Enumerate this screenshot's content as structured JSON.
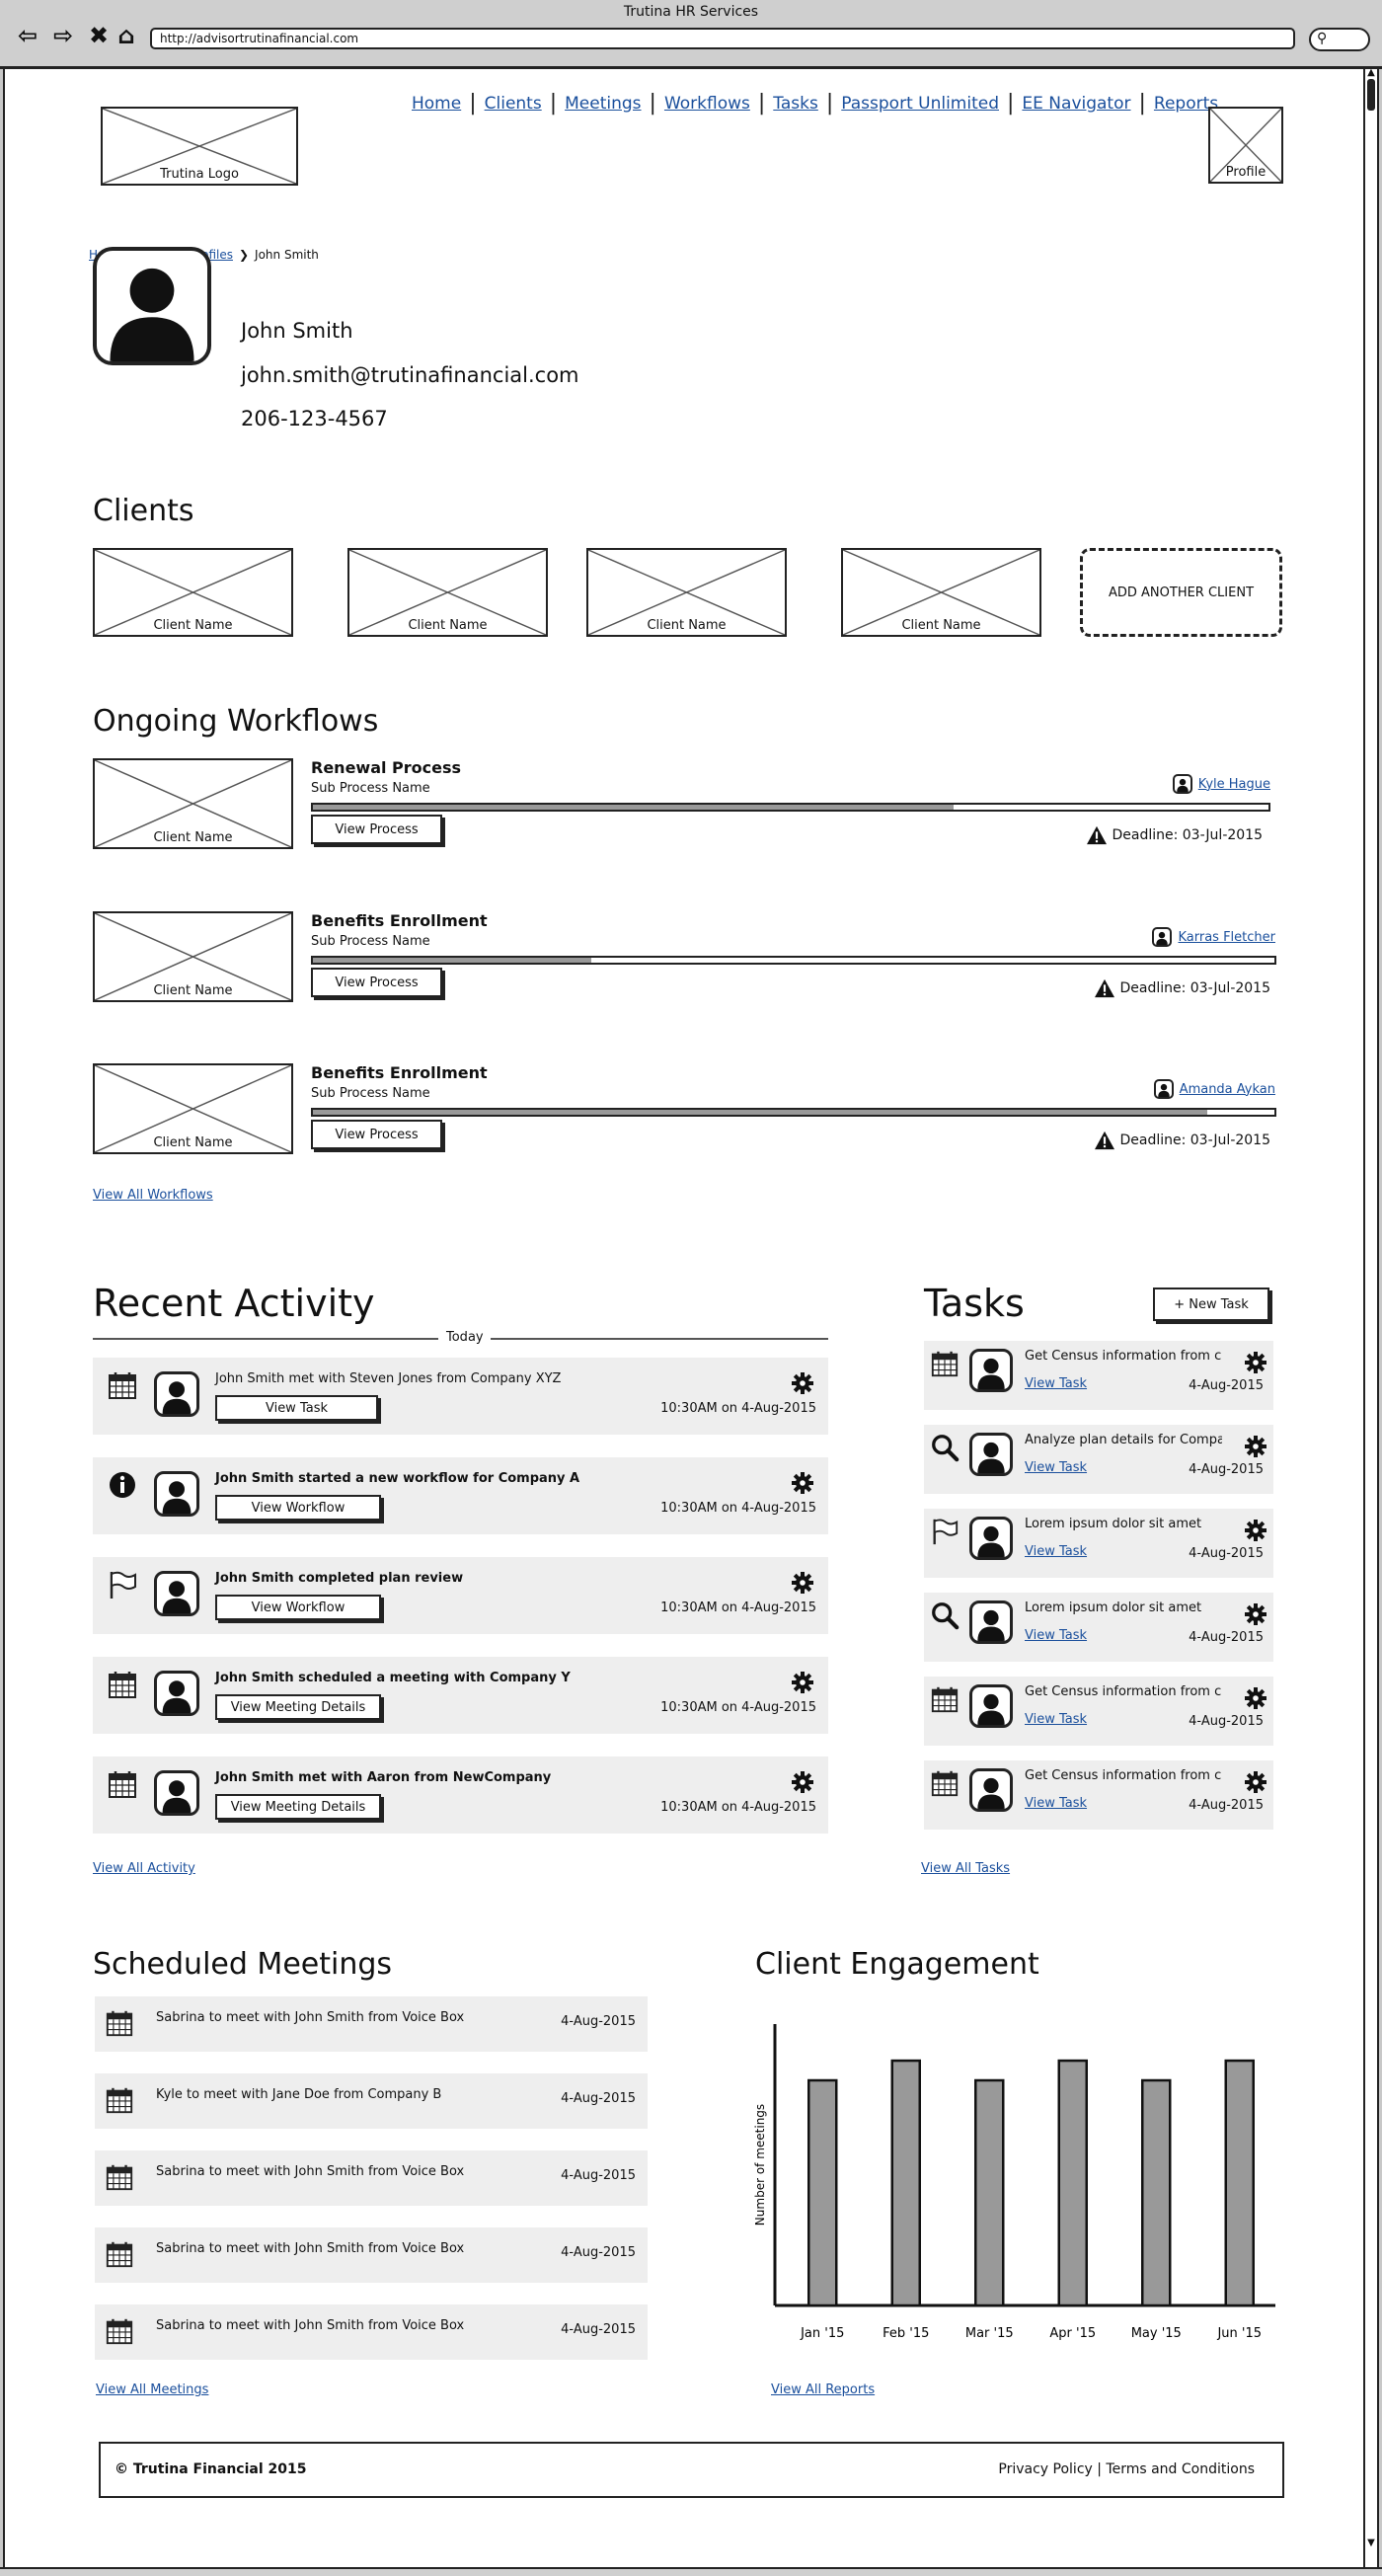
{
  "window": {
    "title": "Trutina HR Services",
    "url": "http://advisortrutinafinancial.com"
  },
  "header": {
    "logo_caption": "Trutina Logo",
    "profile_caption": "Profile",
    "nav": [
      "Home",
      "Clients",
      "Meetings",
      "Workflows",
      "Tasks",
      "Passport Unlimited",
      "EE Navigator",
      "Reports"
    ]
  },
  "breadcrumb": {
    "home": "Home",
    "profiles": "Trutina Profiles",
    "current": "John Smith"
  },
  "profile": {
    "name": "John Smith",
    "email": "john.smith@trutinafinancial.com",
    "phone": "206-123-4567"
  },
  "clients": {
    "title": "Clients",
    "items": [
      "Client Name",
      "Client Name",
      "Client Name",
      "Client Name"
    ],
    "add_label": "ADD ANOTHER CLIENT"
  },
  "workflows": {
    "title": "Ongoing Workflows",
    "items": [
      {
        "client": "Client Name",
        "title": "Renewal Process",
        "sub": "Sub Process Name",
        "button": "View Process",
        "owner": "Kyle Hague",
        "deadline": "Deadline: 03-Jul-2015",
        "progress": 0.67
      },
      {
        "client": "Client Name",
        "title": "Benefits Enrollment",
        "sub": "Sub Process Name",
        "button": "View Process",
        "owner": "Karras Fletcher",
        "deadline": "Deadline: 03-Jul-2015",
        "progress": 0.29
      },
      {
        "client": "Client Name",
        "title": "Benefits Enrollment",
        "sub": "Sub Process Name",
        "button": "View Process",
        "owner": "Amanda Aykan",
        "deadline": "Deadline: 03-Jul-2015",
        "progress": 0.93
      }
    ],
    "view_all": "View All Workflows"
  },
  "activity": {
    "title": "Recent Activity",
    "divider": "Today",
    "items": [
      {
        "icon": "calendar-icon",
        "text": "John Smith met with Steven Jones from Company XYZ",
        "button": "View Task",
        "time": "10:30AM on 4-Aug-2015"
      },
      {
        "icon": "info-icon",
        "text": "John Smith started a new workflow for Company A",
        "button": "View Workflow",
        "time": "10:30AM on 4-Aug-2015"
      },
      {
        "icon": "flag-icon",
        "text": "John Smith completed plan review",
        "button": "View Workflow",
        "time": "10:30AM on 4-Aug-2015"
      },
      {
        "icon": "calendar-icon",
        "text": "John Smith scheduled a meeting with Company Y",
        "button": "View Meeting Details",
        "time": "10:30AM on 4-Aug-2015"
      },
      {
        "icon": "calendar-icon",
        "text": "John Smith met with Aaron from NewCompany",
        "button": "View Meeting Details",
        "time": "10:30AM on 4-Aug-2015"
      }
    ],
    "view_all": "View All Activity"
  },
  "tasks": {
    "title": "Tasks",
    "new_button": "+ New Task",
    "items": [
      {
        "icon": "calendar-icon",
        "text": "Get Census information from company",
        "link": "View Task",
        "date": "4-Aug-2015"
      },
      {
        "icon": "search-icon",
        "text": "Analyze plan details for Company",
        "link": "View Task",
        "date": "4-Aug-2015"
      },
      {
        "icon": "flag-icon",
        "text": "Lorem ipsum dolor sit amet",
        "link": "View Task",
        "date": "4-Aug-2015"
      },
      {
        "icon": "search-icon",
        "text": "Lorem ipsum dolor sit amet",
        "link": "View Task",
        "date": "4-Aug-2015"
      },
      {
        "icon": "calendar-icon",
        "text": "Get Census information from company",
        "link": "View Task",
        "date": "4-Aug-2015"
      },
      {
        "icon": "calendar-icon",
        "text": "Get Census information from company",
        "link": "View Task",
        "date": "4-Aug-2015"
      }
    ],
    "view_all": "View All Tasks"
  },
  "meetings": {
    "title": "Scheduled Meetings",
    "items": [
      {
        "text": "Sabrina to meet with John Smith from Voice Box",
        "date": "4-Aug-2015"
      },
      {
        "text": "Kyle to meet with Jane Doe from Company B",
        "date": "4-Aug-2015"
      },
      {
        "text": "Sabrina to meet with John Smith from Voice Box",
        "date": "4-Aug-2015"
      },
      {
        "text": "Sabrina to meet with John Smith from Voice Box",
        "date": "4-Aug-2015"
      },
      {
        "text": "Sabrina to meet with John Smith from Voice Box",
        "date": "4-Aug-2015"
      }
    ],
    "view_all": "View All Meetings"
  },
  "engagement": {
    "title": "Client Engagement",
    "view_all": "View All Reports"
  },
  "chart_data": {
    "type": "bar",
    "title": "Client Engagement",
    "ylabel": "Number of meetings",
    "xlabel": "",
    "categories": [
      "Jan '15",
      "Feb '15",
      "Mar '15",
      "Apr '15",
      "May '15",
      "Jun '15"
    ],
    "values": [
      0.8,
      0.87,
      0.8,
      0.87,
      0.8,
      0.87
    ],
    "ylim": [
      0,
      1
    ],
    "grid": false
  },
  "footer": {
    "copyright": "© Trutina Financial 2015",
    "links": "Privacy Policy | Terms and Conditions"
  },
  "colors": {
    "link": "#1a4f9c",
    "row_bg": "#eeeeee",
    "bar": "#999999"
  }
}
